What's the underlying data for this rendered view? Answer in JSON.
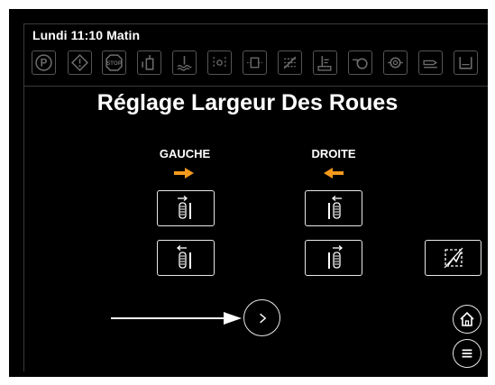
{
  "header": {
    "clock": "Lundi 11:10 Matin"
  },
  "status_icons": [
    "parking-brake-icon",
    "warning-icon",
    "stop-icon",
    "fuel-filter-icon",
    "coolant-level-icon",
    "steering-pressure-icon",
    "hydraulic-pressure-icon",
    "transmission-fault-icon",
    "hydraulic-oil-temp-icon",
    "engine-oil-icon",
    "air-filter-icon",
    "fuel-system-icon",
    "reservoir-icon"
  ],
  "main": {
    "title": "Réglage Largeur Des Roues",
    "left": {
      "label": "GAUCHE"
    },
    "right": {
      "label": "DROITE"
    }
  },
  "colors": {
    "accent": "#f39a1d",
    "text": "#ffffff",
    "background": "#000000"
  }
}
